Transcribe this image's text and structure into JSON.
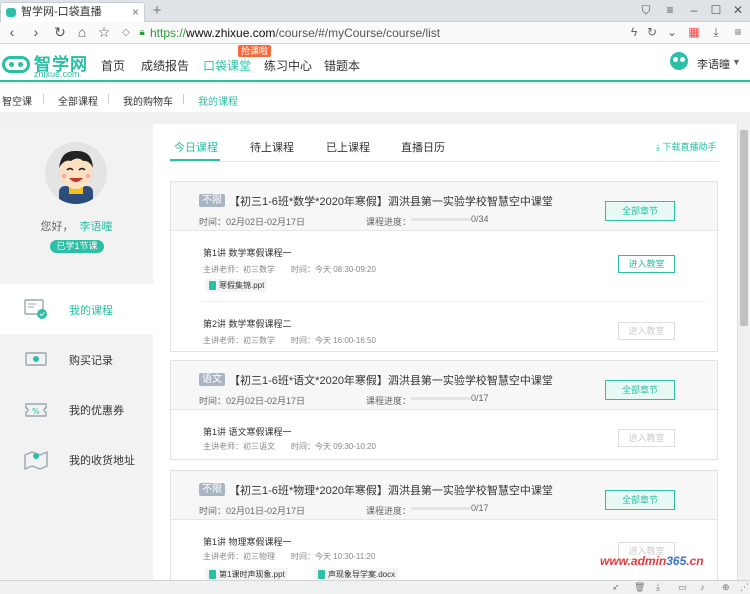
{
  "browser": {
    "tab_title": "智学网-口袋直播",
    "new_tab": "+",
    "url_proto": "https://",
    "url_host": "www.zhixue.com",
    "url_path": "/course/#/myCourse/course/list"
  },
  "site": {
    "logo_cn": "智学网",
    "logo_en": "zhixue.com",
    "nav": [
      "首页",
      "成绩报告",
      "口袋课堂",
      "练习中心",
      "错题本"
    ],
    "hot_badge": "抢课啦",
    "user_name": "李语曈",
    "subnav": [
      "智空课",
      "全部课程",
      "我的购物车",
      "我的课程"
    ]
  },
  "sidebar": {
    "greeting": "您好，",
    "name": "李语曈",
    "learned": "已学1节课",
    "menu": [
      "我的课程",
      "购买记录",
      "我的优惠券",
      "我的收货地址"
    ]
  },
  "main": {
    "tabs": [
      "今日课程",
      "待上课程",
      "已上课程",
      "直播日历"
    ],
    "download": "下载直播助手",
    "cards": [
      {
        "tag": "不限",
        "title": "【初三1-6班*数学*2020年寒假】泗洪县第一实验学校智慧空中课堂",
        "time": "时间：02月02日-02月17日",
        "progress_label": "课程进度：",
        "progress": "0/34",
        "all_btn": "全部章节",
        "lessons": [
          {
            "name": "第1讲 数学寒假课程一",
            "teacher": "主讲老师：初三数学",
            "time": "时间：今天 08:30-09:20",
            "btn": "进入教室",
            "files": [
              "寒假集锦.ppt"
            ]
          },
          {
            "name": "第2讲 数学寒假课程二",
            "teacher": "主讲老师：初三数学",
            "time": "时间：今天 16:00-16:50",
            "btn": "进入教室",
            "files": []
          }
        ]
      },
      {
        "tag": "语文",
        "title": "【初三1-6班*语文*2020年寒假】泗洪县第一实验学校智慧空中课堂",
        "time": "时间：02月02日-02月17日",
        "progress_label": "课程进度：",
        "progress": "0/17",
        "all_btn": "全部章节",
        "lessons": [
          {
            "name": "第1讲 语文寒假课程一",
            "teacher": "主讲老师：初三语文",
            "time": "时间：今天 09:30-10:20",
            "btn": "进入教室",
            "files": []
          }
        ]
      },
      {
        "tag": "不限",
        "title": "【初三1-6班*物理*2020年寒假】泗洪县第一实验学校智慧空中课堂",
        "time": "时间：02月01日-02月17日",
        "progress_label": "课程进度：",
        "progress": "0/17",
        "all_btn": "全部章节",
        "lessons": [
          {
            "name": "第1讲 物理寒假课程一",
            "teacher": "主讲老师：初三物理",
            "time": "时间：今天 10:30-11:20",
            "btn": "进入教室",
            "files": [
              "第1课时声现象.ppt",
              "声现象导学案.docx"
            ]
          }
        ]
      }
    ]
  },
  "watermark": {
    "a": "www.admin",
    "b": "365",
    "c": ".cn"
  },
  "colors": {
    "accent": "#2bbfa5",
    "hot": "#f56a3b",
    "tag": "#a9b5c3"
  }
}
